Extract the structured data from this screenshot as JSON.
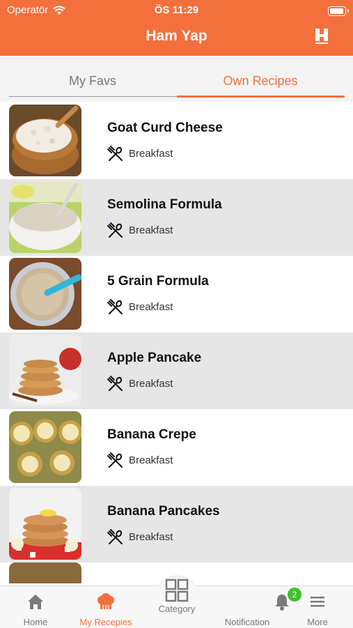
{
  "status_bar": {
    "carrier": "Operatör",
    "time": "ÖS 11:29"
  },
  "header": {
    "title": "Ham Yap",
    "logo_letter": "H",
    "logo_caption": "HamYap"
  },
  "tabs": [
    {
      "label": "My Favs",
      "active": false
    },
    {
      "label": "Own Recipes",
      "active": true
    }
  ],
  "recipes": [
    {
      "title": "Goat Curd Cheese",
      "category": "Breakfast"
    },
    {
      "title": "Semolina Formula",
      "category": "Breakfast"
    },
    {
      "title": "5 Grain Formula",
      "category": "Breakfast"
    },
    {
      "title": "Apple Pancake",
      "category": "Breakfast"
    },
    {
      "title": "Banana Crepe",
      "category": "Breakfast"
    },
    {
      "title": "Banana Pancakes",
      "category": "Breakfast"
    }
  ],
  "tabbar": {
    "home": "Home",
    "my_recipes": "My Recepies",
    "category": "Category",
    "notification": "Notification",
    "notification_badge": "2",
    "more": "More"
  },
  "colors": {
    "accent": "#f36f3b",
    "badge": "#3fbf2c",
    "alt_row": "#e6e6e6"
  }
}
